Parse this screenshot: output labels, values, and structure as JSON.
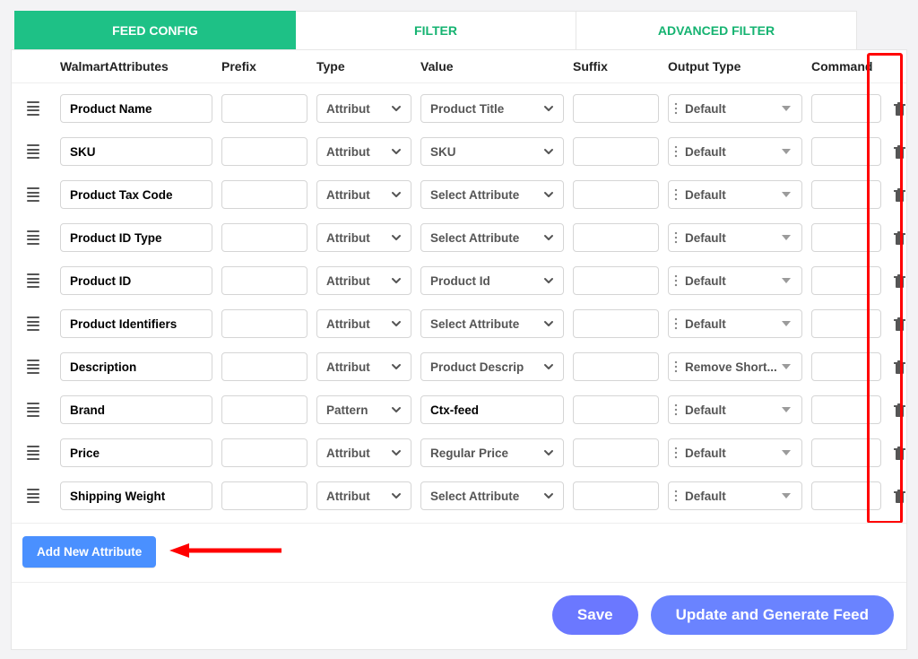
{
  "tabs": {
    "feed_config": "FEED CONFIG",
    "filter": "FILTER",
    "advanced_filter": "ADVANCED FILTER",
    "active": "feed_config"
  },
  "columns": {
    "c0": "",
    "c1": "WalmartAttributes",
    "c2": "Prefix",
    "c3": "Type",
    "c4": "Value",
    "c5": "Suffix",
    "c6": "Output Type",
    "c7": "Command",
    "c8": ""
  },
  "rows": [
    {
      "attr": "Product Name",
      "prefix": "",
      "type": "Attribute",
      "value": "Product Title",
      "suffix": "",
      "output": "Default",
      "command": ""
    },
    {
      "attr": "SKU",
      "prefix": "",
      "type": "Attribute",
      "value": "SKU",
      "suffix": "",
      "output": "Default",
      "command": ""
    },
    {
      "attr": "Product Tax Code",
      "prefix": "",
      "type": "Attribute",
      "value": "Select Attribute",
      "suffix": "",
      "output": "Default",
      "command": ""
    },
    {
      "attr": "Product ID Type",
      "prefix": "",
      "type": "Attribute",
      "value": "Select Attribute",
      "suffix": "",
      "output": "Default",
      "command": ""
    },
    {
      "attr": "Product ID",
      "prefix": "",
      "type": "Attribute",
      "value": "Product Id",
      "suffix": "",
      "output": "Default",
      "command": ""
    },
    {
      "attr": "Product Identifiers",
      "prefix": "",
      "type": "Attribute",
      "value": "Select Attribute",
      "suffix": "",
      "output": "Default",
      "command": ""
    },
    {
      "attr": "Description",
      "prefix": "",
      "type": "Attribute",
      "value": "Product Description",
      "suffix": "",
      "output": "Remove Short...",
      "command": ""
    },
    {
      "attr": "Brand",
      "prefix": "",
      "type": "Pattern",
      "value": "Ctx-feed",
      "suffix": "",
      "output": "Default",
      "command": ""
    },
    {
      "attr": "Price",
      "prefix": "",
      "type": "Attribute",
      "value": "Regular Price",
      "suffix": "",
      "output": "Default",
      "command": ""
    },
    {
      "attr": "Shipping Weight",
      "prefix": "",
      "type": "Attribute",
      "value": "Select Attribute",
      "suffix": "",
      "output": "Default",
      "command": ""
    }
  ],
  "type_display": {
    "Attribute": "Attribut",
    "Pattern": "Pattern"
  },
  "value_display": {
    "Product Title": "Product Title",
    "SKU": "SKU",
    "Select Attribute": "Select Attribute",
    "Product Id": "Product Id",
    "Product Description": "Product Descrip",
    "Ctx-feed": "Ctx-feed",
    "Regular Price": "Regular Price"
  },
  "buttons": {
    "add": "Add New Attribute",
    "save": "Save",
    "generate": "Update and Generate Feed"
  },
  "colors": {
    "green": "#1ec186",
    "green_text": "#15b371",
    "blue": "#4a90ff",
    "pill1": "#6b78ff",
    "pill2": "#6a83ff",
    "red": "#ff0000"
  }
}
